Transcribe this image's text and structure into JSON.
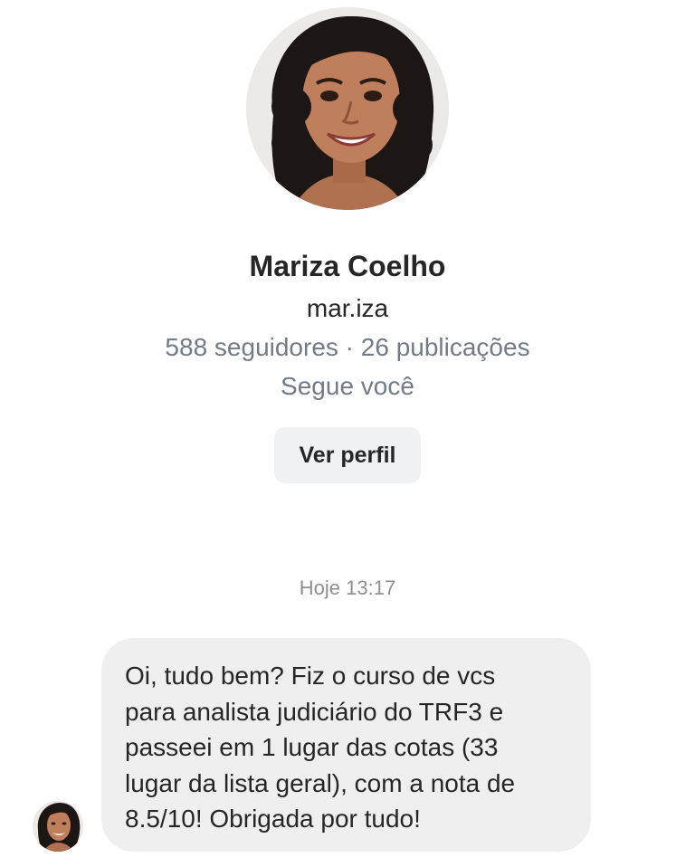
{
  "profile": {
    "avatar_icon": "profile-photo",
    "name": "Mariza Coelho",
    "username": "mar.iza",
    "stats": "588 seguidores · 26 publicações",
    "follow_status": "Segue você",
    "view_profile_label": "Ver perfil"
  },
  "conversation": {
    "timestamp": "Hoje 13:17",
    "messages": [
      {
        "sender_avatar_icon": "sender-profile-photo",
        "text": "Oi, tudo bem? Fiz o curso de vcs\npara analista judiciário do TRF3 e\npasseei em 1 lugar das cotas (33\nlugar da lista geral), com a nota de\n8.5/10! Obrigada por tudo!"
      }
    ]
  },
  "colors": {
    "background": "#ffffff",
    "primary_text": "#262626",
    "secondary_text": "#737b86",
    "timestamp_text": "#8e8e8e",
    "button_bg": "#eff1f3",
    "bubble_bg": "#efefef"
  }
}
